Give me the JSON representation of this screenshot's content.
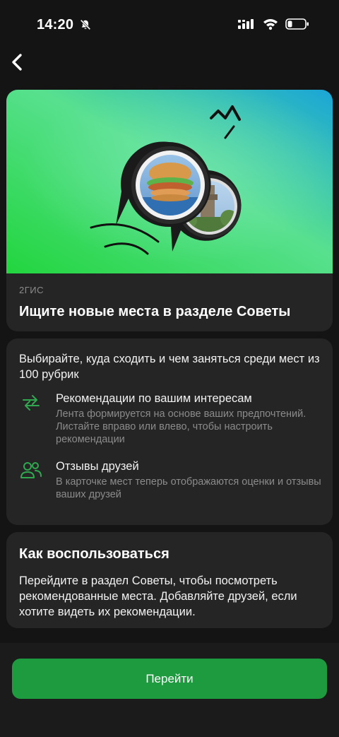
{
  "status_bar": {
    "time": "14:20",
    "icons": [
      "bell-slash-icon",
      "signal-icon",
      "wifi-icon",
      "battery-icon"
    ]
  },
  "nav": {
    "back_icon": "chevron-left-icon"
  },
  "hero": {
    "source": "2ГИС",
    "title": "Ищите новые места в разделе Советы",
    "gradient_colors": [
      "#2fd94b",
      "#6ee39a",
      "#1ba9d6"
    ]
  },
  "info": {
    "lead": "Выбирайте, куда сходить и чем заняться среди мест из 100 рубрик",
    "features": [
      {
        "icon": "arrows-swap-icon",
        "title": "Рекомендации по вашим интересам",
        "description": "Лента формируется на основе ваших предпочтений. Листайте вправо или влево, чтобы настроить рекомендации"
      },
      {
        "icon": "friends-icon",
        "title": "Отзывы друзей",
        "description": "В карточке мест теперь отображаются оценки и отзывы ваших друзей"
      }
    ]
  },
  "howto": {
    "title": "Как воспользоваться",
    "text": "Перейдите в раздел Советы, чтобы посмотреть рекомендованные места. Добавляйте друзей, если хотите видеть их рекомендации."
  },
  "action": {
    "button_label": "Перейти"
  },
  "colors": {
    "accent": "#1f9b3f",
    "icon_green": "#2fa84f",
    "card_bg": "#252525",
    "page_bg": "#141414"
  }
}
